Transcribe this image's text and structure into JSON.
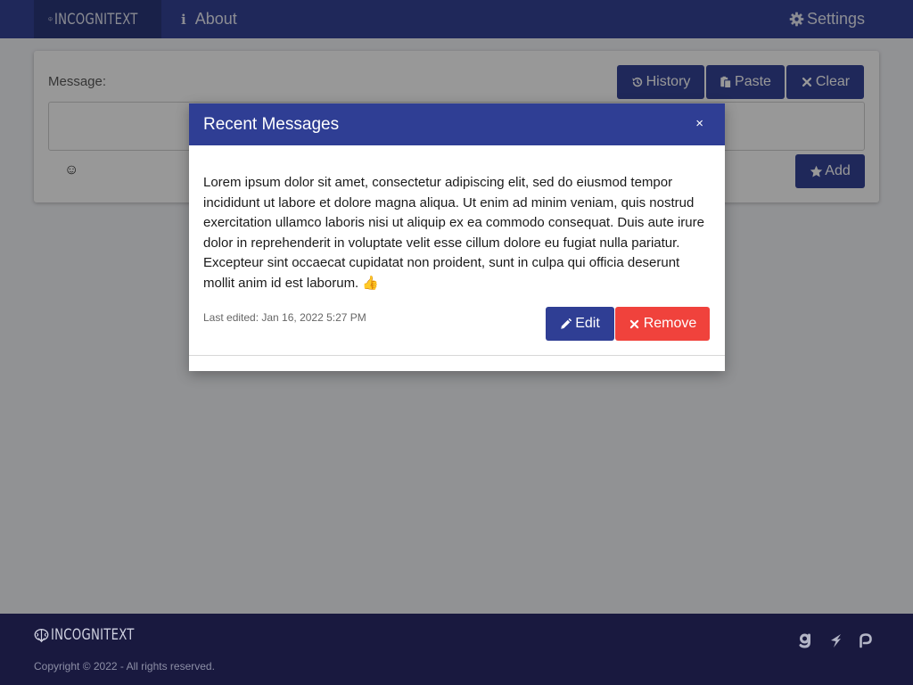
{
  "navbar": {
    "brand": "INCOGNITEXT",
    "about": "About",
    "settings": "Settings"
  },
  "composer": {
    "label": "Message:",
    "history": "History",
    "paste": "Paste",
    "clear": "Clear",
    "input_value": "",
    "emoji": "☺",
    "add": "Add"
  },
  "modal": {
    "title": "Recent Messages",
    "close": "×",
    "message": "Lorem ipsum dolor sit amet, consectetur adipiscing elit, sed do eiusmod tempor incididunt ut labore et dolore magna aliqua. Ut enim ad minim veniam, quis nostrud exercitation ullamco laboris nisi ut aliquip ex ea commodo consequat. Duis aute irure dolor in reprehenderit in voluptate velit esse cillum dolore eu fugiat nulla pariatur. Excepteur sint occaecat cupidatat non proident, sunt in culpa qui officia deserunt mollit anim id est laborum. 👍",
    "last_edited": "Last edited: Jan 16, 2022 5:27 PM",
    "edit": "Edit",
    "remove": "Remove"
  },
  "footer": {
    "brand": "INCOGNITEXT",
    "copyright": "Copyright © 2022 - All rights reserved.",
    "social_icons": [
      "gitlab-g-icon",
      "fiverr-icon",
      "patreon-icon"
    ]
  },
  "colors": {
    "primary": "#2f3e94",
    "brand_dark": "#253278",
    "danger": "#f0423c",
    "footer": "#19193f"
  }
}
